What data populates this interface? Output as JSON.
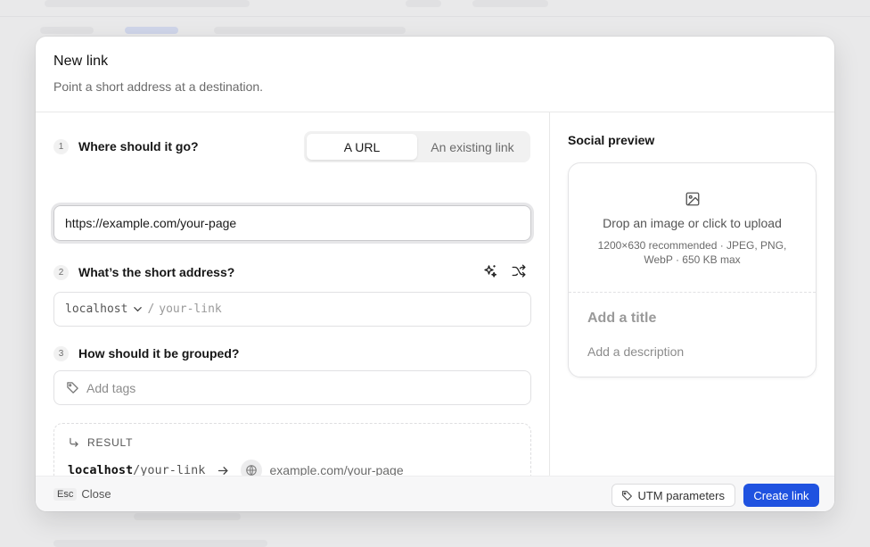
{
  "dialog": {
    "title": "New link",
    "subtitle": "Point a short address at a destination."
  },
  "destination": {
    "step_number": "1",
    "label": "Where should it go?",
    "tabs": [
      {
        "label": "A URL",
        "active": true
      },
      {
        "label": "An existing link",
        "active": false
      }
    ],
    "url_value": "https://example.com/your-page"
  },
  "short_address": {
    "step_number": "2",
    "label": "What’s the short address?",
    "domain": "localhost",
    "separator": "/",
    "slug_placeholder": "your-link",
    "icons": [
      "sparkles-icon",
      "shuffle-icon"
    ]
  },
  "grouping": {
    "step_number": "3",
    "label": "How should it be grouped?",
    "tags_placeholder": "Add tags"
  },
  "result": {
    "label": "RESULT",
    "short_domain": "localhost",
    "short_path": "/your-link",
    "destination": "example.com/your-page"
  },
  "social_preview": {
    "title": "Social preview",
    "upload_text": "Drop an image or click to upload",
    "upload_hint": "1200×630 recommended · JPEG, PNG, WebP · 650 KB max",
    "title_placeholder": "Add a title",
    "description_placeholder": "Add a description"
  },
  "footer": {
    "esc_key": "Esc",
    "close_label": "Close",
    "utm_label": "UTM parameters",
    "create_label": "Create link"
  },
  "colors": {
    "primary": "#1f52e0",
    "border": "#e1e1e3",
    "muted_text": "#6b6b6b"
  }
}
